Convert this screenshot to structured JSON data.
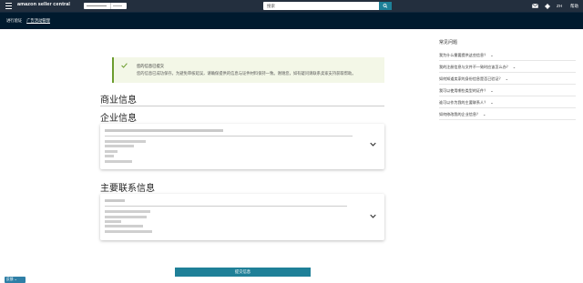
{
  "header": {
    "brand": "amazon seller central",
    "search_placeholder": "搜索",
    "language": "ZH",
    "help": "帮助",
    "icons": [
      "menu-icon",
      "mail-icon",
      "gear-icon",
      "search-icon"
    ]
  },
  "breadcrumb": {
    "item1": "进行验证",
    "item2": "广告活动管理"
  },
  "alert": {
    "title": "您的信息已提交",
    "body": "您的信息已成功保存。为避免审核延误，请确保提供的信息与证件材料保持一致。谢谢您，如有疑问请联系卖家支持获取帮助。"
  },
  "main": {
    "business_info": "商业信息",
    "company_info": "企业信息",
    "contact_info": "主要联系信息",
    "submit": "提交信息"
  },
  "faq": {
    "title": "常见问题",
    "items": [
      "我为什么需要提供这些信息？",
      "我的注册信息与文件不一致时应该怎么办？",
      "如何知道卖家的身份信息是否已验证？",
      "我可以使用哪些类型的证件？",
      "谁可以作为我的主要联系人？",
      "如何修改我的企业信息？"
    ]
  },
  "feedback": "反馈",
  "colors": {
    "topbar": "#232f3e",
    "subbar": "#001a2e",
    "accent": "#1f8098",
    "success": "#6c9d2e"
  }
}
